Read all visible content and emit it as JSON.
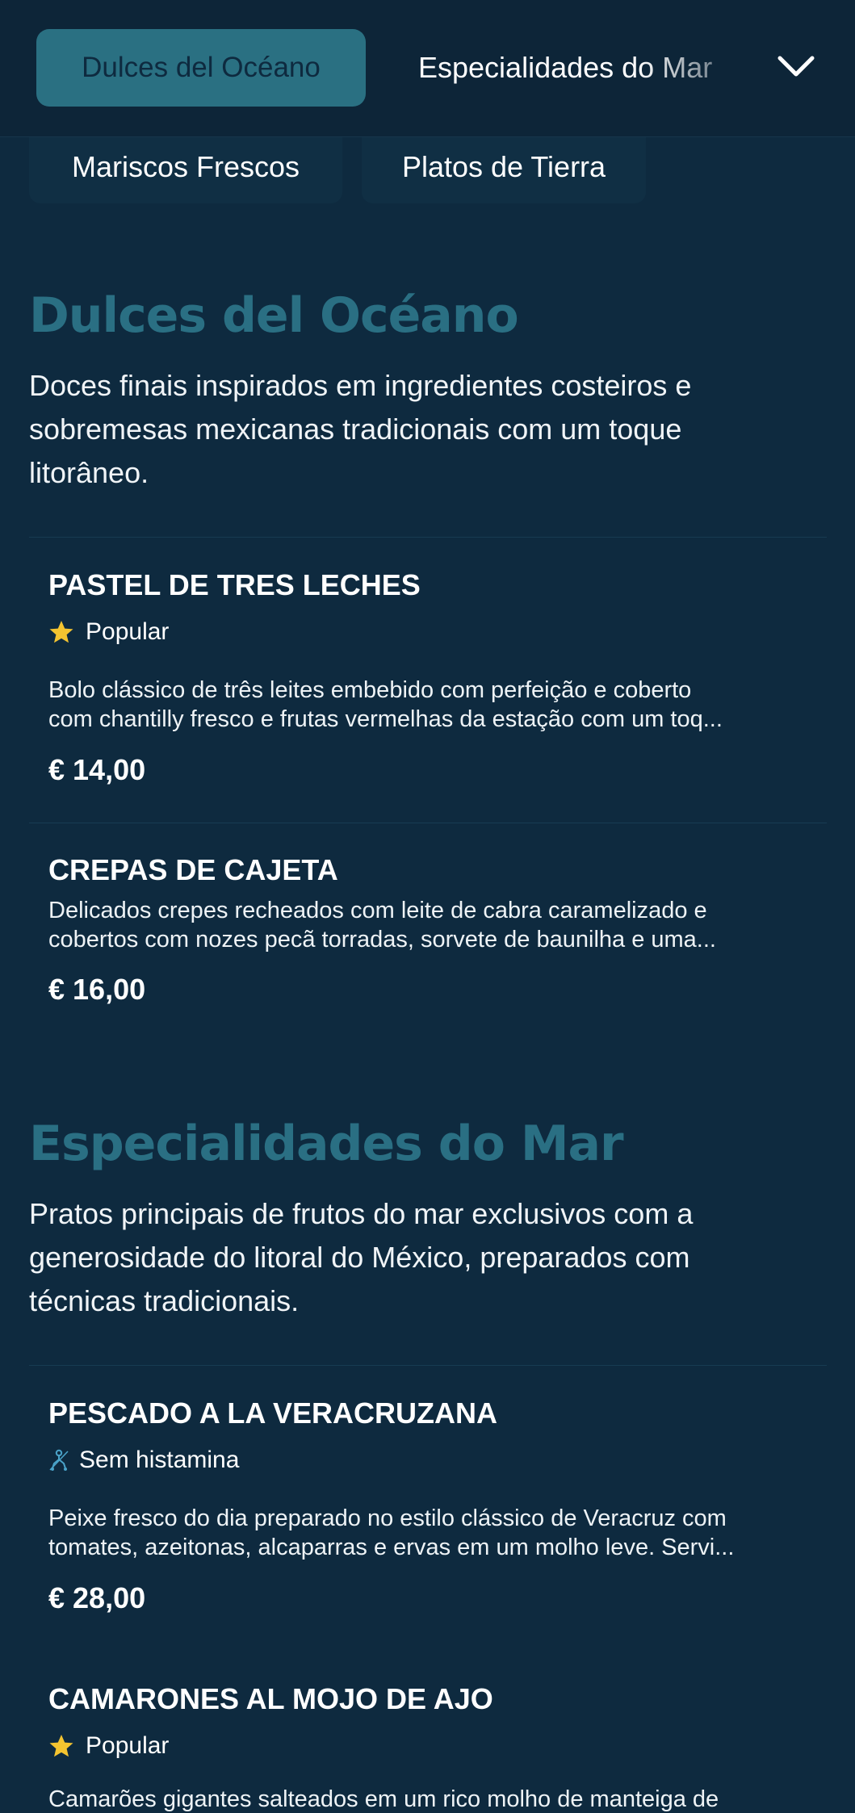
{
  "nav": {
    "active_tab": "Dulces del Océano",
    "next_tab": "Especialidades do Mar",
    "more_icon": "chevron-down-icon",
    "row2_tabs": [
      "Mariscos Frescos",
      "Platos de Tierra"
    ]
  },
  "sections": [
    {
      "title": "Dulces del Océano",
      "description_lines": [
        "Doces finais inspirados em ingredientes costeiros e",
        "sobremesas mexicanas tradicionais com um toque",
        "litorâneo."
      ],
      "items": [
        {
          "name": "PASTEL DE TRES LECHES",
          "badge": "Popular",
          "badge_icon": "star-icon",
          "description_lines": [
            "Bolo clássico de três leites embebido com perfeição e coberto",
            "com chantilly fresco e frutas vermelhas da estação com um toq..."
          ],
          "price": "€ 14,00"
        },
        {
          "name": "CREPAS DE CAJETA",
          "description_lines": [
            "Delicados crepes recheados com leite de cabra caramelizado e",
            "cobertos com nozes pecã torradas, sorvete de baunilha e uma..."
          ],
          "price": "€ 16,00"
        }
      ]
    },
    {
      "title": "Especialidades do Mar",
      "description_lines": [
        "Pratos principais de frutos do mar exclusivos com a",
        "generosidade do litoral do México, preparados com",
        "técnicas tradicionais."
      ],
      "items": [
        {
          "name": "PESCADO A LA VERACRUZANA",
          "badge": "Sem histamina",
          "badge_icon": "histamine-free-icon",
          "description_lines": [
            "Peixe fresco do dia preparado no estilo clássico de Veracruz com",
            "tomates, azeitonas, alcaparras e ervas em um molho leve. Servi..."
          ],
          "price": "€ 28,00"
        },
        {
          "name": "CAMARONES AL MOJO DE AJO",
          "badge": "Popular",
          "badge_icon": "star-icon",
          "description_lines": [
            "Camarões gigantes salteados em um rico molho de manteiga de"
          ]
        }
      ]
    }
  ],
  "colors": {
    "background": "#0e2a3f",
    "header": "#0d2538",
    "accent": "#2a7082",
    "star": "#f4c430"
  }
}
